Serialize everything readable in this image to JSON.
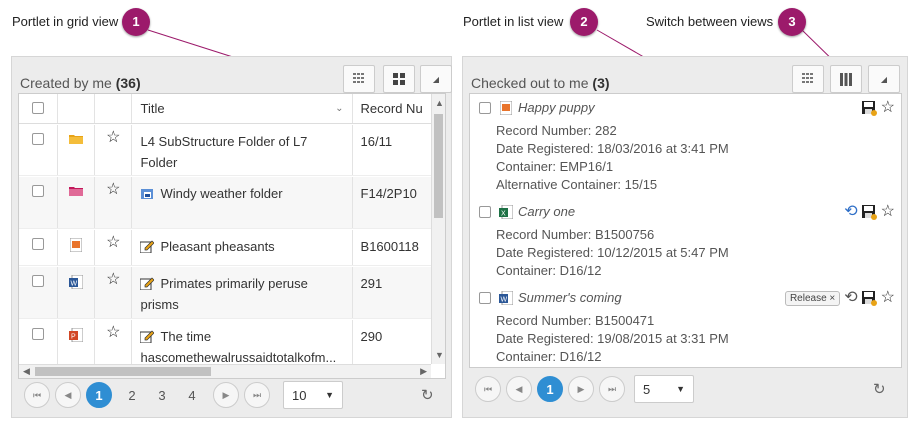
{
  "callouts": [
    {
      "label": "Portlet in grid view",
      "num": "1"
    },
    {
      "label": "Portlet in list view",
      "num": "2"
    },
    {
      "label": "Switch between views",
      "num": "3"
    }
  ],
  "grid_portlet": {
    "title": "Created by me",
    "count": "(36)",
    "columns": {
      "title": "Title",
      "record": "Record Nu"
    },
    "rows": [
      {
        "icon": "folder-icon",
        "title": "L4 SubStructure Folder of L7 Folder",
        "record": "16/11",
        "type_icon": ""
      },
      {
        "icon": "folder-icon",
        "title": "Windy weather folder",
        "record": "F14/2P10",
        "type_icon": "folder-container-icon"
      },
      {
        "icon": "image-doc-icon",
        "title": "Pleasant pheasants",
        "record": "B1600118",
        "type_icon": "edit-icon"
      },
      {
        "icon": "word-doc-icon",
        "title": "Primates primarily peruse prisms",
        "record": "291",
        "type_icon": "edit-icon"
      },
      {
        "icon": "powerpoint-doc-icon",
        "title": "The time hascomethewalrussaidtotalkofm...",
        "record": "290",
        "type_icon": "edit-icon"
      }
    ],
    "pages": [
      "1",
      "2",
      "3",
      "4"
    ],
    "current_page": "1",
    "page_size": "10"
  },
  "list_portlet": {
    "title": "Checked out to me",
    "count": "(3)",
    "items": [
      {
        "title": "Happy puppy",
        "fields": [
          "Record Number: 282",
          "Date Registered: 18/03/2016 at 3:41 PM",
          "Container: EMP16/1",
          "Alternative Container: 15/15"
        ],
        "tag": ""
      },
      {
        "title": "Carry one",
        "fields": [
          "Record Number: B1500756",
          "Date Registered: 10/12/2015 at 5:47 PM",
          "Container: D16/12"
        ],
        "tag": ""
      },
      {
        "title": "Summer's coming",
        "fields": [
          "Record Number: B1500471",
          "Date Registered: 19/08/2015 at 3:31 PM",
          "Container: D16/12"
        ],
        "tag": "Release ×"
      }
    ],
    "current_page": "1",
    "page_size": "5"
  },
  "colors": {
    "accent": "#9c1a6b",
    "pager_active": "#2f8ed3"
  }
}
